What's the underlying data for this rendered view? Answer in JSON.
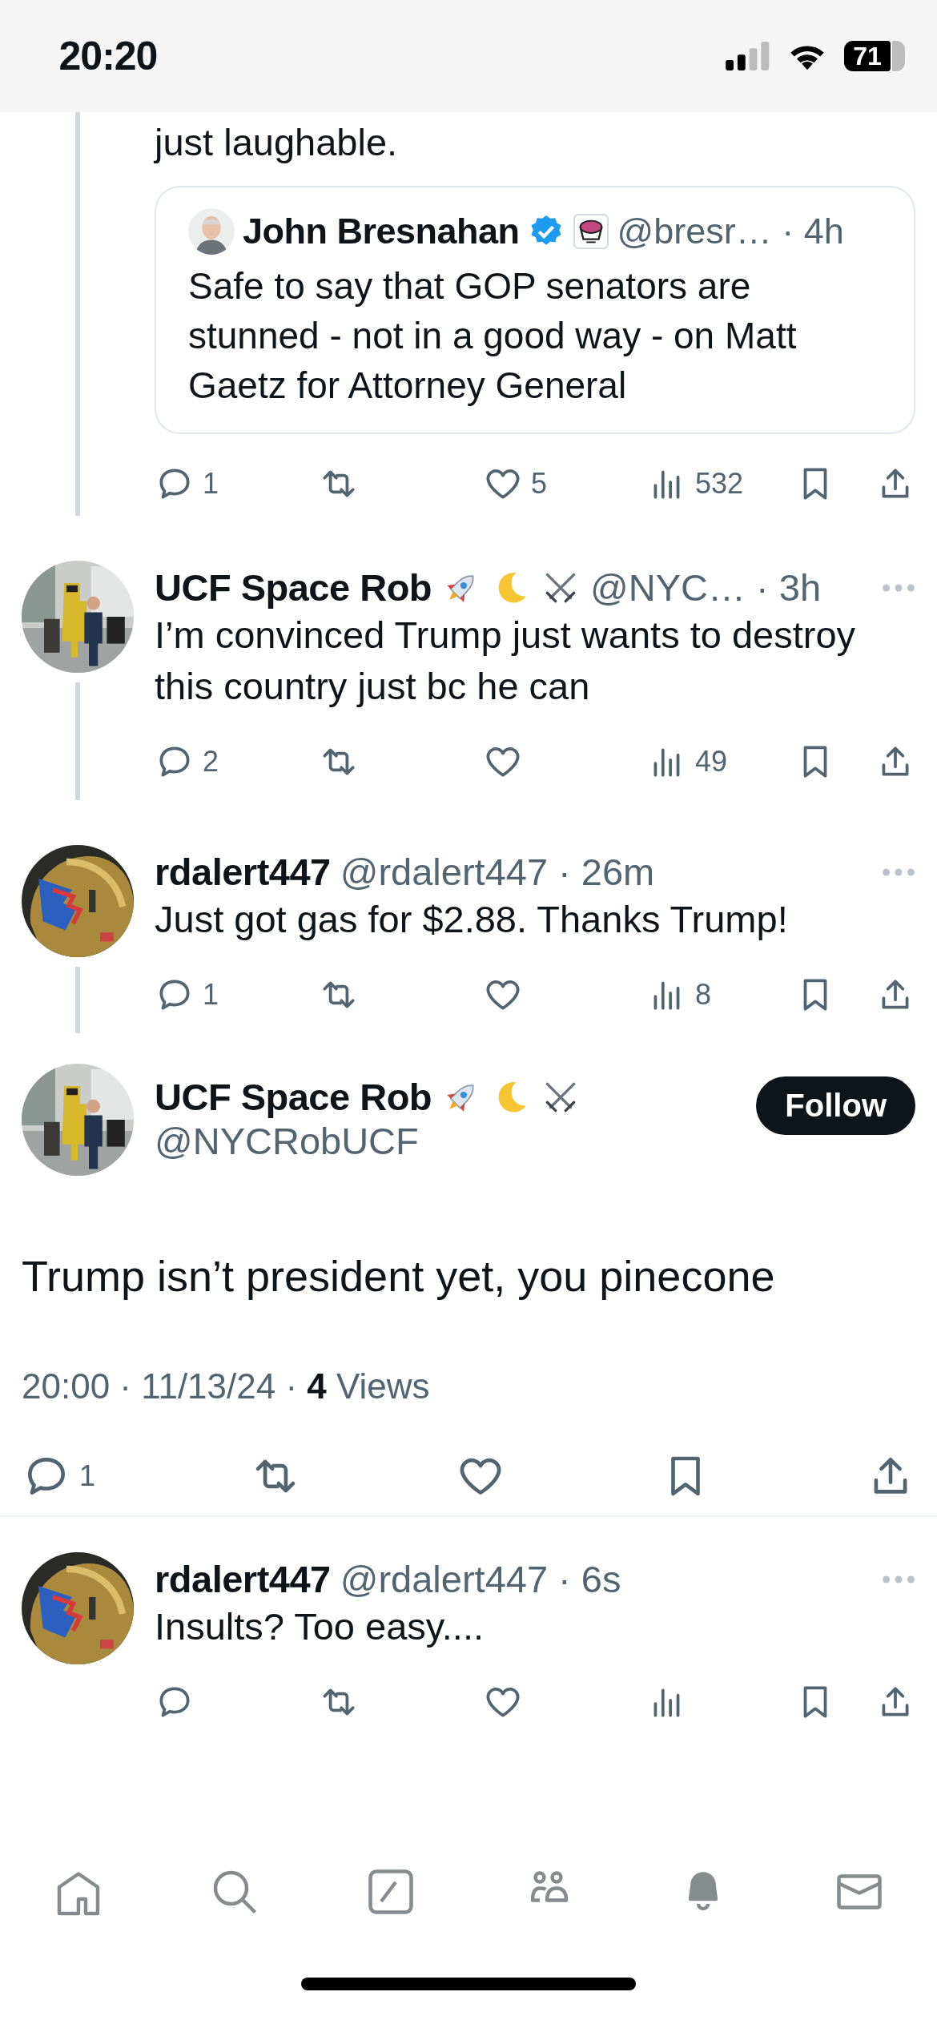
{
  "status_bar": {
    "time": "20:20",
    "battery": "71"
  },
  "previous_post": {
    "text_tail": "just laughable.",
    "quote": {
      "name": "John Bresnahan",
      "verified": true,
      "badges": [
        {
          "kind": "emblem"
        }
      ],
      "handle_time": "@bresr… · 4h",
      "text": "Safe to say that GOP senators are stunned -  not in a good way - on Matt Gaetz for Attorney General"
    },
    "actions": [
      {
        "kind": "reply",
        "count": "1"
      },
      {
        "kind": "repost"
      },
      {
        "kind": "like",
        "count": "5"
      },
      {
        "kind": "views",
        "count": "532"
      },
      {
        "kind": "bookmark"
      },
      {
        "kind": "share"
      }
    ]
  },
  "replies": [
    {
      "name": "UCF Space Rob",
      "badges": [
        {
          "kind": "rocket"
        },
        {
          "kind": "moon"
        },
        {
          "kind": "swords"
        }
      ],
      "handle_time": "@NYC… · 3h",
      "text": "I’m convinced Trump just wants to destroy this country just bc he can",
      "actions": [
        {
          "kind": "reply",
          "count": "2"
        },
        {
          "kind": "repost"
        },
        {
          "kind": "like"
        },
        {
          "kind": "views",
          "count": "49"
        },
        {
          "kind": "bookmark"
        },
        {
          "kind": "share"
        }
      ]
    },
    {
      "name": "rdalert447",
      "handle_time": "@rdalert447 · 26m",
      "text": "Just got gas for $2.88. Thanks Trump!",
      "actions": [
        {
          "kind": "reply",
          "count": "1"
        },
        {
          "kind": "repost"
        },
        {
          "kind": "like"
        },
        {
          "kind": "views",
          "count": "8"
        },
        {
          "kind": "bookmark"
        },
        {
          "kind": "share"
        }
      ]
    }
  ],
  "focused_post": {
    "name": "UCF Space Rob",
    "badges": [
      {
        "kind": "rocket"
      },
      {
        "kind": "moon"
      },
      {
        "kind": "swords"
      }
    ],
    "handle": "@NYCRobUCF",
    "follow_label": "Follow",
    "text": "Trump isn’t president yet, you pinecone",
    "meta": "20:00 · 11/13/24 · **4** Views",
    "actions": [
      {
        "kind": "reply",
        "count": "1"
      },
      {
        "kind": "repost"
      },
      {
        "kind": "like"
      },
      {
        "kind": "bookmark"
      },
      {
        "kind": "share"
      }
    ]
  },
  "later_replies": [
    {
      "name": "rdalert447",
      "handle_time": "@rdalert447 · 6s",
      "text": "Insults? Too easy....",
      "actions": [
        {
          "kind": "reply"
        },
        {
          "kind": "repost"
        },
        {
          "kind": "like"
        },
        {
          "kind": "views"
        },
        {
          "kind": "bookmark"
        },
        {
          "kind": "share"
        }
      ]
    }
  ],
  "tab_bar": [
    {
      "kind": "home"
    },
    {
      "kind": "search"
    },
    {
      "kind": "compose"
    },
    {
      "kind": "communities"
    },
    {
      "kind": "notifications"
    },
    {
      "kind": "messages"
    }
  ]
}
